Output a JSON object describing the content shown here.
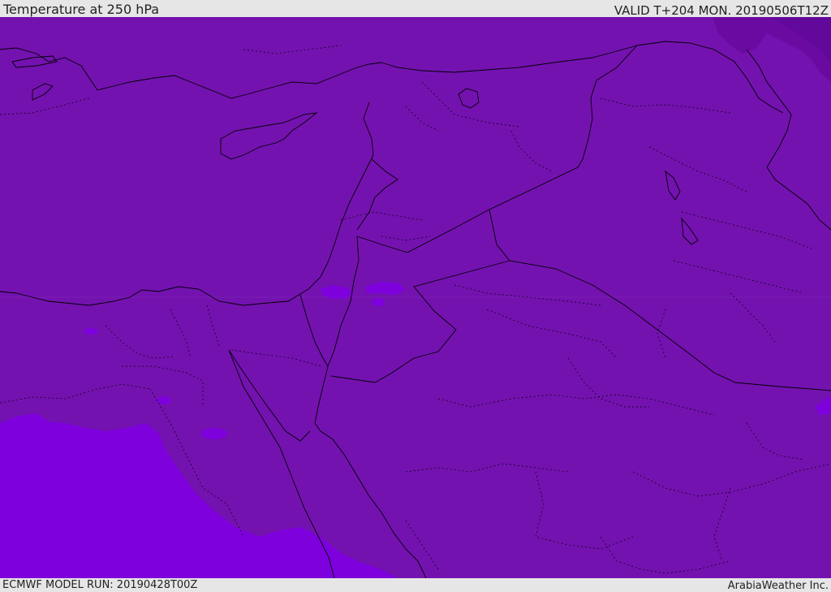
{
  "header": {
    "title": "Temperature at 250 hPa",
    "valid_time": "VALID T+204 MON. 20190506T12Z"
  },
  "footer": {
    "model_run": "ECMWF MODEL RUN: 20190428T00Z",
    "credit": "ArabiaWeather Inc."
  },
  "colors": {
    "field_main": "#7412b0",
    "field_warm_patch": "#7d00dd",
    "field_cold_patch": "#6a0aa0",
    "border_line": "#000000"
  }
}
